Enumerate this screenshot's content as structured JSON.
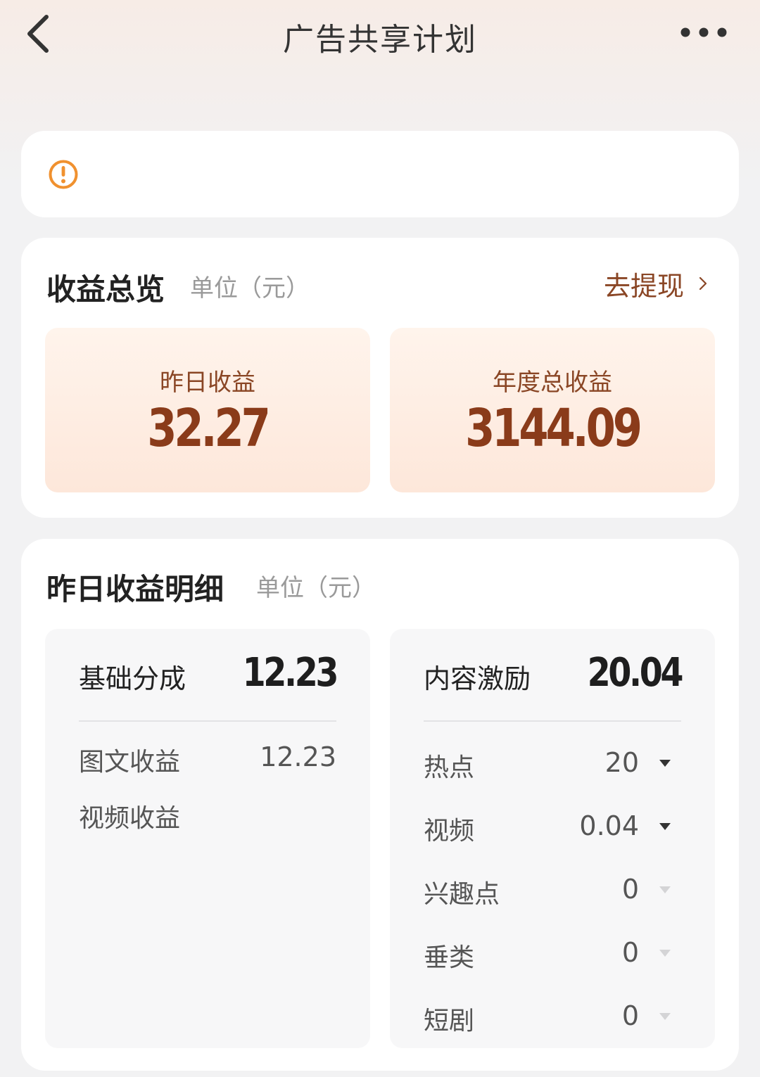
{
  "header": {
    "title": "广告共享计划"
  },
  "overview": {
    "title": "收益总览",
    "unit": "单位（元）",
    "withdraw_label": "去提现",
    "yesterday_label": "昨日收益",
    "yesterday_value": "32.27",
    "annual_label": "年度总收益",
    "annual_value": "3144.09"
  },
  "detail": {
    "title": "昨日收益明细",
    "unit": "单位（元）",
    "base": {
      "label": "基础分成",
      "total": "12.23",
      "items": [
        {
          "label": "图文收益",
          "value": "12.23"
        },
        {
          "label": "视频收益",
          "value": ""
        }
      ]
    },
    "incentive": {
      "label": "内容激励",
      "total": "20.04",
      "items": [
        {
          "label": "热点",
          "value": "20"
        },
        {
          "label": "视频",
          "value": "0.04"
        },
        {
          "label": "兴趣点",
          "value": "0"
        },
        {
          "label": "垂类",
          "value": "0"
        },
        {
          "label": "短剧",
          "value": "0"
        }
      ]
    }
  },
  "icons": {
    "back": "chevron-left-icon",
    "more": "more-dots-icon",
    "notice": "warning-circle-icon",
    "withdraw_arrow": "chevron-right-icon",
    "row_expand": "caret-down-icon"
  },
  "colors": {
    "accent_brown": "#8a4625",
    "value_brown": "#8a3b1a",
    "warning_orange": "#f0912f",
    "tile_gradient_top": "#fff4ec",
    "tile_gradient_bottom": "#fde7da"
  }
}
